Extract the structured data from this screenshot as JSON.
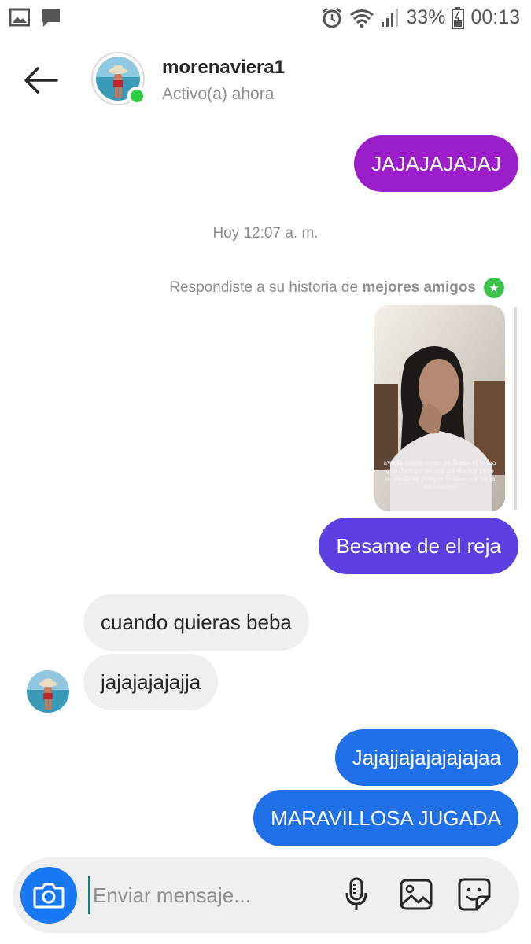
{
  "status_bar": {
    "battery": "33%",
    "time": "00:13",
    "icons": [
      "gallery-icon",
      "message-icon",
      "alarm-icon",
      "wifi-icon",
      "signal-icon",
      "battery-icon"
    ]
  },
  "header": {
    "username": "morenaviera1",
    "activity": "Activo(a) ahora",
    "online": true
  },
  "messages": [
    {
      "from": "me",
      "text": "JAJAJAJAJAJ",
      "color": "#9b1fc8"
    },
    {
      "from": "me",
      "text": "Besame de el reja",
      "color": "#5b3fe0"
    },
    {
      "from": "them",
      "text": "cuando quieras beba"
    },
    {
      "from": "them",
      "text": "jajajajajajja"
    },
    {
      "from": "me",
      "text": "Jajajjajajajajajaa",
      "color": "#1f6fe8"
    },
    {
      "from": "me",
      "text": "MARAVILLOSA JUGADA",
      "color": "#1f6fe8"
    }
  ],
  "timestamp": "Hoy 12:07 a. m.",
  "story_reply": {
    "note_prefix": "Respondiste a su historia de",
    "note_bold": "mejores amigos",
    "caption": "ayuda gente como se llama el tema que dice yo no soy un doctor pero se medicar porque lo busco y no la encuentro"
  },
  "composer": {
    "placeholder": "Enviar mensaje...",
    "icons": [
      "camera-icon",
      "microphone-icon",
      "image-icon",
      "sticker-icon"
    ]
  },
  "colors": {
    "accent": "#1877f2",
    "online": "#2ecc40",
    "close_friends": "#3bc24b"
  }
}
